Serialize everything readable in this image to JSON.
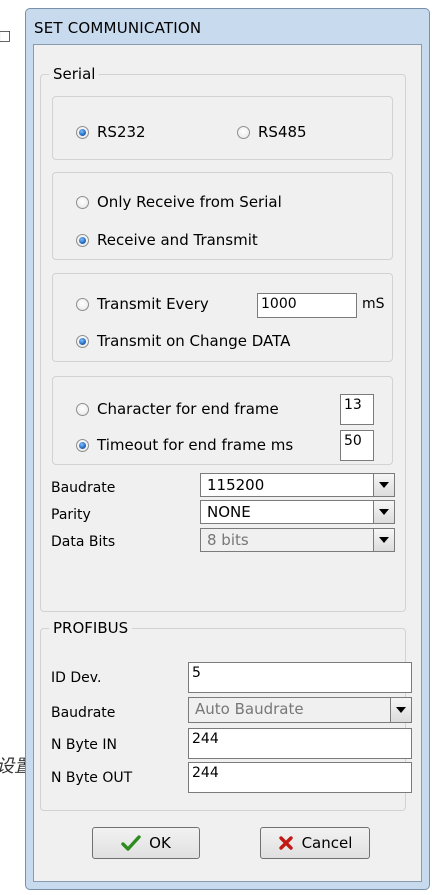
{
  "background": {
    "glyph_top": "□",
    "glyph_bottom": "设置"
  },
  "dialog": {
    "title": "SET COMMUNICATION",
    "serial": {
      "legend": "Serial",
      "port": {
        "rs232": "RS232",
        "rs485": "RS485",
        "selected": "RS232"
      },
      "mode": {
        "only_receive": "Only Receive from Serial",
        "receive_transmit": "Receive and Transmit",
        "selected": "Receive and Transmit"
      },
      "transmit": {
        "every_label": "Transmit Every",
        "every_value": "1000",
        "every_unit": "mS",
        "on_change": "Transmit on Change DATA",
        "selected": "Transmit on Change DATA"
      },
      "endframe": {
        "char_label": "Character for end frame",
        "char_value": "13",
        "timeout_label": "Timeout for end frame ms",
        "timeout_value": "50",
        "selected": "Timeout for end frame ms"
      },
      "baudrate_label": "Baudrate",
      "baudrate_value": "115200",
      "parity_label": "Parity",
      "parity_value": "NONE",
      "databits_label": "Data Bits",
      "databits_value": "8 bits"
    },
    "profibus": {
      "legend": "PROFIBUS",
      "id_label": "ID Dev.",
      "id_value": "5",
      "baudrate_label": "Baudrate",
      "baudrate_value": "Auto Baudrate",
      "byte_in_label": "N Byte IN",
      "byte_in_value": "244",
      "byte_out_label": "N Byte OUT",
      "byte_out_value": "244"
    },
    "buttons": {
      "ok": "OK",
      "cancel": "Cancel"
    },
    "colors": {
      "frame": "#c8daed",
      "ok_icon": "#2e8b1e",
      "cancel_icon": "#c01a12"
    }
  }
}
